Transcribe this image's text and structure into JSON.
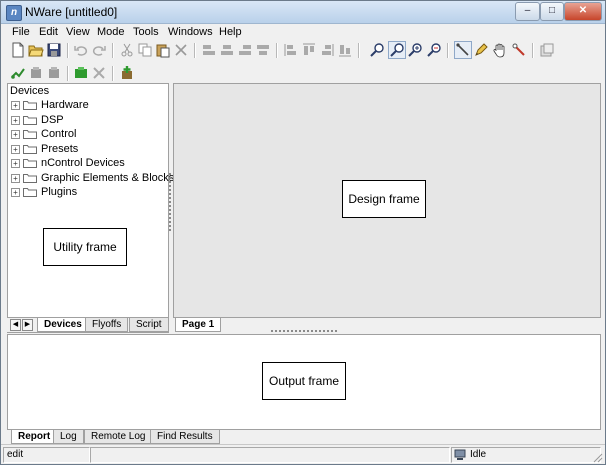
{
  "window": {
    "title": "NWare [untitled0]",
    "app_icon_glyph": "n",
    "minimize_glyph": "–",
    "maximize_glyph": "□",
    "close_glyph": "✕"
  },
  "menubar": {
    "items": [
      "File",
      "Edit",
      "View",
      "Mode",
      "Tools",
      "Windows",
      "Help"
    ]
  },
  "toolbar1": [
    "new-file-icon",
    "open-folder-icon",
    "save-icon",
    "undo-icon",
    "redo-icon",
    "cut-icon",
    "copy-icon",
    "paste-icon",
    "delete-icon",
    "align-left-icon",
    "align-center-icon",
    "align-right-icon",
    "align-justify-icon",
    "distribute-left-icon",
    "distribute-top-icon",
    "distribute-right-icon",
    "distribute-bottom-icon",
    "zoom-out-icon",
    "zoom-icon",
    "zoom-in-icon",
    "zoom-fit-icon",
    "wire-tool-icon",
    "pen-tool-icon",
    "hand-tool-icon",
    "probe-tool-icon",
    "properties-icon"
  ],
  "toolbar2": [
    "connect-icon",
    "device-icon",
    "device-alt-icon",
    "build-icon",
    "tools-icon",
    "add-device-icon"
  ],
  "utility": {
    "header": "Devices",
    "tree": [
      "Hardware",
      "DSP",
      "Control",
      "Presets",
      "nControl Devices",
      "Graphic Elements & Blocks",
      "Plugins"
    ],
    "tabs": [
      "Devices",
      "Flyoffs",
      "Script"
    ],
    "nav_left": "◀",
    "nav_right": "▶"
  },
  "design": {
    "tabs": [
      "Page 1"
    ]
  },
  "output": {
    "tabs": [
      "Report",
      "Log",
      "Remote Log",
      "Find Results"
    ]
  },
  "callouts": {
    "utility": "Utility frame",
    "design": "Design frame",
    "output": "Output frame"
  },
  "status": {
    "mode": "edit",
    "state": "Idle"
  },
  "colors": {
    "title_gradient_top": "#d9e7f6",
    "close": "#c7452b",
    "design_bg": "#e6e6e6"
  }
}
